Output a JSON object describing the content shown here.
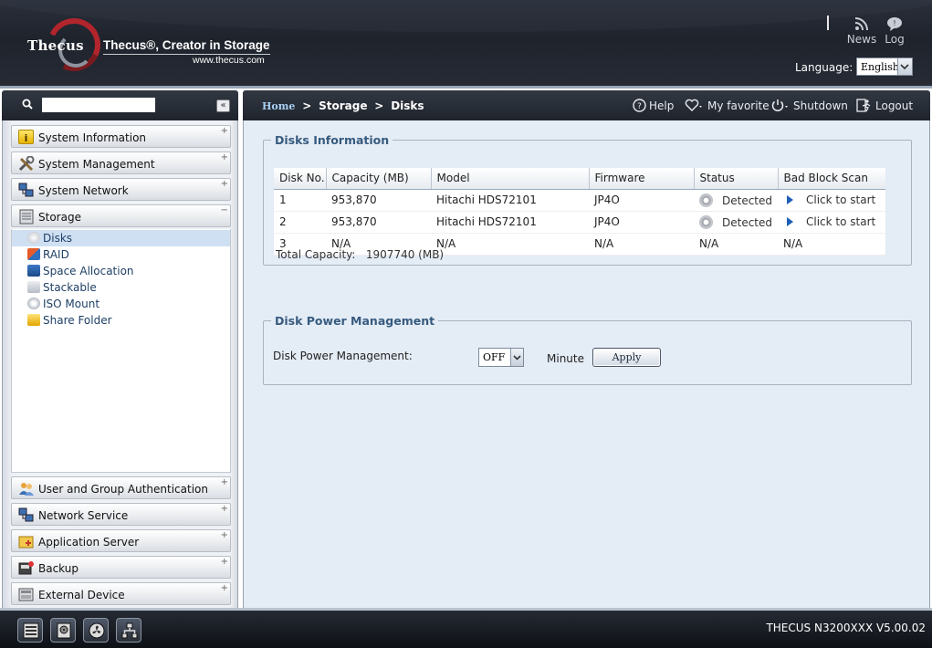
{
  "header": {
    "brand": "Thecus",
    "tagline": "Thecus®, Creator in Storage",
    "url": "www.thecus.com",
    "news_label": "News",
    "log_label": "Log",
    "language_label": "Language:",
    "language_value": "English"
  },
  "search": {
    "placeholder": "",
    "collapse_glyph": "«"
  },
  "breadcrumb": {
    "home": "Home",
    "storage": "Storage",
    "disks": "Disks",
    "separator": ">"
  },
  "top_actions": {
    "help": "Help",
    "favorite": "My favorite",
    "shutdown": "Shutdown",
    "logout": "Logout"
  },
  "sidebar": {
    "top_items": [
      {
        "label": "System Information",
        "icon": "info-icon"
      },
      {
        "label": "System Management",
        "icon": "tools-icon"
      },
      {
        "label": "System Network",
        "icon": "network-icon"
      },
      {
        "label": "Storage",
        "icon": "storage-icon"
      }
    ],
    "storage_items": [
      {
        "label": "Disks",
        "icon": "disk-icon"
      },
      {
        "label": "RAID",
        "icon": "raid-icon"
      },
      {
        "label": "Space Allocation",
        "icon": "space-allocation-icon"
      },
      {
        "label": "Stackable",
        "icon": "stackable-icon"
      },
      {
        "label": "ISO Mount",
        "icon": "iso-mount-icon"
      },
      {
        "label": "Share Folder",
        "icon": "share-folder-icon"
      }
    ],
    "bottom_items": [
      {
        "label": "User and Group Authentication",
        "icon": "users-icon"
      },
      {
        "label": "Network Service",
        "icon": "network-service-icon"
      },
      {
        "label": "Application Server",
        "icon": "app-server-icon"
      },
      {
        "label": "Backup",
        "icon": "backup-icon"
      },
      {
        "label": "External Device",
        "icon": "external-device-icon"
      }
    ],
    "expand_glyph": "+",
    "collapse_glyph": "−"
  },
  "disks_info": {
    "legend": "Disks Information",
    "columns": [
      "Disk No.",
      "Capacity (MB)",
      "Model",
      "Firmware",
      "Status",
      "Bad Block Scan"
    ],
    "rows": [
      {
        "no": "1",
        "capacity": "953,870",
        "model": "Hitachi HDS72101",
        "firmware": "JP4O",
        "status": "Detected",
        "scan": "Click to start"
      },
      {
        "no": "2",
        "capacity": "953,870",
        "model": "Hitachi HDS72101",
        "firmware": "JP4O",
        "status": "Detected",
        "scan": "Click to start"
      },
      {
        "no": "3",
        "capacity": "N/A",
        "model": "N/A",
        "firmware": "N/A",
        "status": "N/A",
        "scan": "N/A"
      }
    ],
    "total_label": "Total Capacity:",
    "total_value": "1907740 (MB)"
  },
  "power": {
    "legend": "Disk Power Management",
    "label": "Disk Power Management:",
    "value": "OFF",
    "unit": "Minute",
    "apply_label": "Apply"
  },
  "footer": {
    "version": "THECUS N3200XXX V5.00.02"
  },
  "colors": {
    "header_bg": "#1e232c",
    "accent_blue": "#375b7e",
    "main_bg": "#e4ecf6",
    "selected_row": "#cfe0f3",
    "logo_red": "#b2252c"
  }
}
